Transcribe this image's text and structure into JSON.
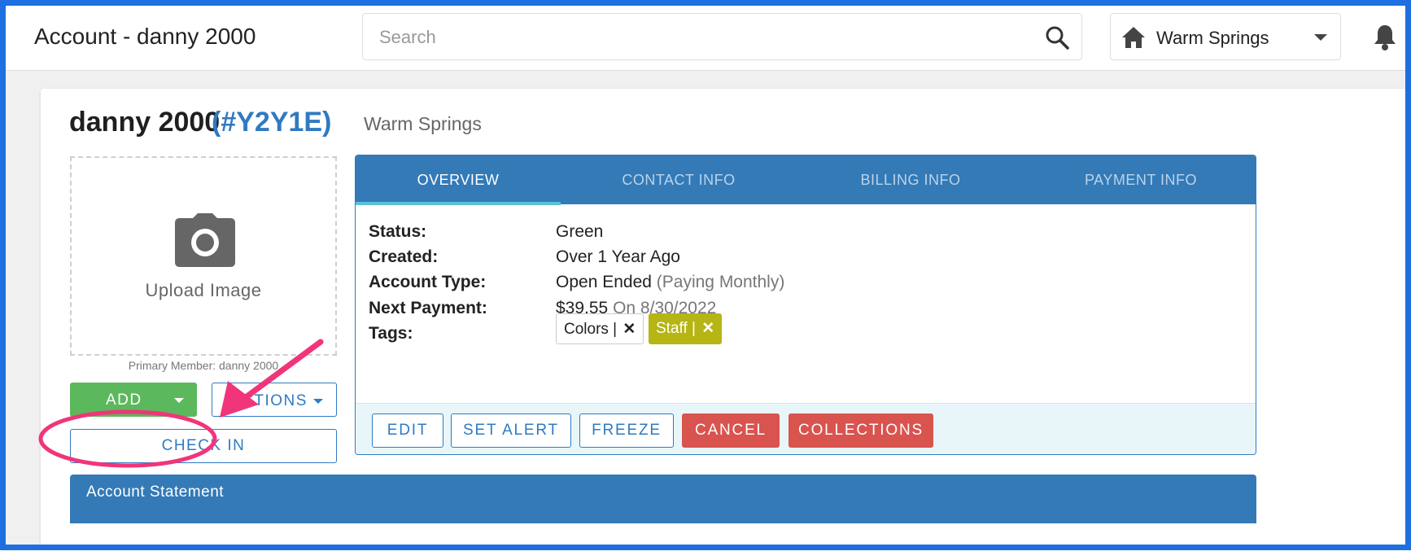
{
  "header": {
    "title": "Account - danny 2000",
    "search_placeholder": "Search",
    "location": "Warm Springs"
  },
  "member": {
    "name": "danny 2000",
    "id": "(#Y2Y1E)",
    "location": "Warm Springs",
    "upload_label": "Upload Image",
    "primary_member": "Primary Member: danny 2000"
  },
  "buttons": {
    "add": "ADD",
    "actions": "ACTIONS",
    "check_in": "CHECK IN"
  },
  "tabs": [
    {
      "label": "OVERVIEW",
      "active": true
    },
    {
      "label": "CONTACT INFO",
      "active": false
    },
    {
      "label": "BILLING INFO",
      "active": false
    },
    {
      "label": "PAYMENT INFO",
      "active": false
    }
  ],
  "overview": {
    "status_label": "Status:",
    "status_value": "Green",
    "created_label": "Created:",
    "created_value": "Over 1 Year Ago",
    "account_type_label": "Account Type:",
    "account_type_value": "Open Ended",
    "account_type_note": "(Paying Monthly)",
    "next_payment_label": "Next Payment:",
    "next_payment_amount": "$39.55",
    "next_payment_date": "On 8/30/2022",
    "tags_label": "Tags:",
    "tags": [
      {
        "label": "Colors |",
        "color": "#ffffff"
      },
      {
        "label": "Staff |",
        "color": "#b5b514"
      }
    ]
  },
  "action_bar": {
    "edit": "EDIT",
    "set_alert": "SET ALERT",
    "freeze": "FREEZE",
    "cancel": "CANCEL",
    "collections": "COLLECTIONS"
  },
  "statement": {
    "title": "Account Statement"
  },
  "colors": {
    "primary": "#337ab7",
    "success": "#5cb85c",
    "danger": "#d9534f",
    "annotation": "#f0357a",
    "frame": "#1e6fe0"
  }
}
